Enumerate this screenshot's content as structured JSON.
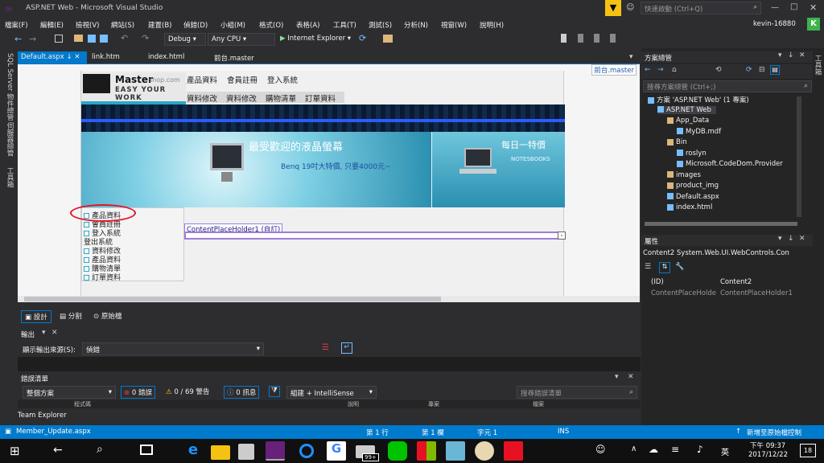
{
  "app": {
    "title": "ASP.NET Web - Microsoft Visual Studio",
    "quick_launch": "快速啟動 (Ctrl+Q)",
    "user": "kevin-16880",
    "avatar": "K"
  },
  "menu": [
    "檔案(F)",
    "編輯(E)",
    "檢視(V)",
    "網站(S)",
    "建置(B)",
    "偵錯(D)",
    "小組(M)",
    "格式(O)",
    "表格(A)",
    "工具(T)",
    "測試(S)",
    "分析(N)",
    "視窗(W)",
    "說明(H)"
  ],
  "toolbar": {
    "config": "Debug",
    "platform": "Any CPU",
    "run": "Internet Explorer"
  },
  "left_tools": [
    "SQL Server 物件總管",
    "伺服器總管",
    "工具箱"
  ],
  "tabs": [
    {
      "label": "Default.aspx",
      "active": true
    },
    {
      "label": "link.htm"
    },
    {
      "label": "index.html"
    },
    {
      "label": "前台.master"
    }
  ],
  "editor": {
    "master_label": "前台.master",
    "logo": {
      "main": "Master",
      "sub": "shop.com",
      "slogan": "EASY YOUR WORK"
    },
    "topnav1": [
      "產品資料",
      "會員註冊",
      "登入系統"
    ],
    "topnav2": [
      "資料修改",
      "資料修改",
      "購物清單",
      "訂單資料"
    ],
    "banner": {
      "headline": "最受歡迎的液晶螢幕",
      "promo": "Benq 19吋大特價, 只要4000元~",
      "side_title": "每日一特價",
      "side_sub": "NOTESBOOKS"
    },
    "sidemenu": [
      "產品資料",
      "會員註冊",
      "登入系統",
      "登出系統",
      "資料修改",
      "產品資料",
      "購物清單",
      "訂單資料"
    ],
    "placeholder": "ContentPlaceHolder1 (自訂)"
  },
  "viewbar": {
    "design": "設計",
    "split": "分割",
    "source": "原始檔"
  },
  "output": {
    "title": "輸出",
    "source_label": "顯示輸出來源(S):",
    "source_value": "偵錯"
  },
  "errors": {
    "title": "錯誤清單",
    "scope": "整個方案",
    "errors": "0 錯誤",
    "warnings": "0 / 69 警告",
    "messages": "0 訊息",
    "build": "組建 + IntelliSense",
    "search": "搜尋錯誤清單",
    "cols": [
      "程式碼",
      "說明",
      "專案",
      "檔案"
    ]
  },
  "team_explorer": "Team Explorer",
  "solution": {
    "title": "方案總管",
    "search": "搜尋方案總管 (Ctrl+;)",
    "items": [
      {
        "label": "方案 'ASP.NET Web' (1 專案)",
        "indent": 0
      },
      {
        "label": "ASP.NET Web",
        "indent": 1
      },
      {
        "label": "App_Data",
        "indent": 2
      },
      {
        "label": "MyDB.mdf",
        "indent": 3
      },
      {
        "label": "Bin",
        "indent": 2
      },
      {
        "label": "roslyn",
        "indent": 3
      },
      {
        "label": "Microsoft.CodeDom.Provider",
        "indent": 3
      },
      {
        "label": "images",
        "indent": 2
      },
      {
        "label": "product_img",
        "indent": 2
      },
      {
        "label": "Default.aspx",
        "indent": 2
      },
      {
        "label": "index.html",
        "indent": 2
      }
    ]
  },
  "properties": {
    "title": "屬性",
    "object": "Content2 System.Web.UI.WebControls.Con",
    "rows": [
      {
        "name": "(ID)",
        "value": "Content2"
      },
      {
        "name": "ContentPlaceHolde",
        "value": "ContentPlaceHolder1"
      }
    ]
  },
  "right_tool": "工具箱",
  "status": {
    "file": "Member_Update.aspx",
    "line": "第 1 行",
    "col": "第 1 欄",
    "char": "字元 1",
    "ins": "INS",
    "vcs": "新增至原始檔控制"
  },
  "taskbar": {
    "time": "下午 09:37",
    "date": "2017/12/22",
    "ime": "英",
    "badge": "99+",
    "notif": "18"
  },
  "colors": {
    "accent": "#007acc",
    "vs_purple": "#68217a",
    "highlight_red": "#e81123"
  }
}
